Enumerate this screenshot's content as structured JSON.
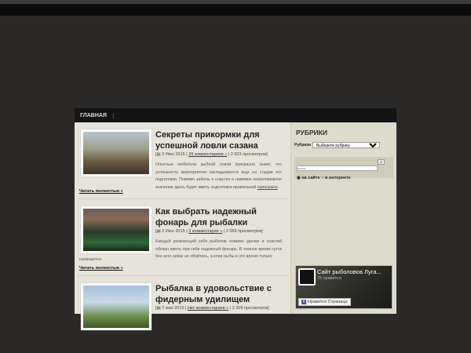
{
  "nav": {
    "home": "ГЛАВНАЯ"
  },
  "posts": [
    {
      "title": "Секреты прикормки для успешной ловли сазана",
      "date": "2 Июн 2015",
      "comments": "29 комментариев »",
      "views": "2 823 просмотров",
      "excerpt": "Опытные любители рыбной ловли прекрасно знают, что успешность мероприятия закладывается еще на стадии его подготовки. Помимо заботы о снастях и наживке немаловажное значение здесь будет иметь подготовка правильной",
      "excerpt_link": "прикормки",
      "more": "Читать полностью »"
    },
    {
      "title": "Как выбрать надежный фонарь для рыбалки",
      "date": "2 Июн 2015",
      "comments": "3 комментария »",
      "views": "2 066 просмотров",
      "excerpt": "Каждый уважающий себя рыболов помимо удочки и снастей обязан иметь при себе надежный фонарь. В темное время суток без него никак не обойтись, а клев рыбы в это время только",
      "excerpt_tail": "начинается",
      "more": "Читать полностью »"
    },
    {
      "title": "Рыбалка в удовольствие с фидерным удилищем",
      "date": "7 мая 2015",
      "comments": "Нет комментариев »",
      "views": "2 306 просмотров"
    }
  ],
  "sidebar": {
    "heading": "РУБРИКИ",
    "cat_label": "Рубрики",
    "cat_select": "Выберите рубрику",
    "search_placeholder": "поиск",
    "radio_site": "на сайте",
    "radio_web": "в интернете",
    "fb": {
      "name": "Сайт рыболовов Луга...",
      "likes": "75 нравится",
      "like_btn": "Нравится Страница"
    }
  }
}
